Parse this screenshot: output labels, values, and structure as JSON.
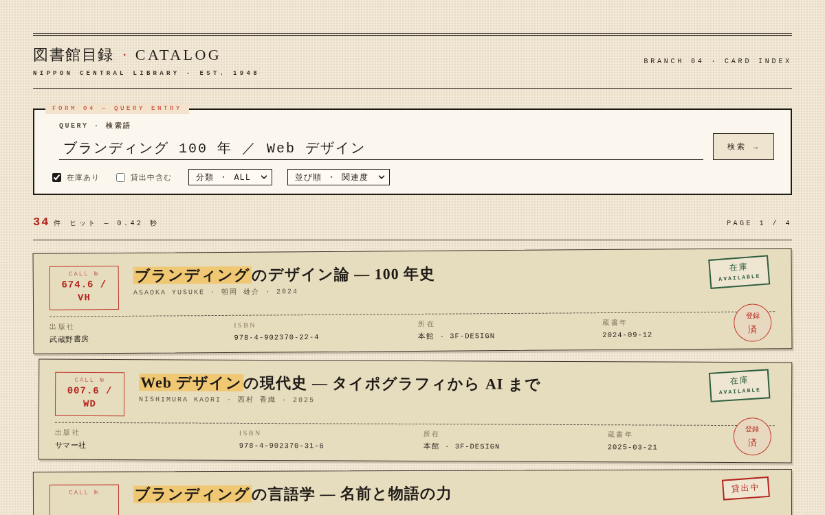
{
  "masthead": {
    "title": {
      "main": "図書館目録",
      "mark": "·",
      "sub": "CATALOG"
    },
    "subtitle": "NIPPON CENTRAL LIBRARY - EST. 1948",
    "branch": "BRANCH 04 · CARD INDEX"
  },
  "query_form": {
    "legend": "FORM 04 — QUERY ENTRY",
    "label": "QUERY · 検索語",
    "value": "ブランディング 100 年 ／ Web デザイン",
    "submit": "検索 →",
    "filters": [
      {
        "label": "在庫あり",
        "checked": true
      },
      {
        "label": "貸出中含む",
        "checked": false
      }
    ],
    "dropdowns": [
      {
        "value": "分類 ・ ALL"
      },
      {
        "value": "並び順 ・ 関連度"
      }
    ]
  },
  "results": {
    "count": "34",
    "summary": "件 ヒット — 0.42 秒",
    "page": "PAGE 1 / 4"
  },
  "cards": [
    {
      "call_label": "CALL №",
      "call_number": "674.6 / VH",
      "title": [
        {
          "text": "ブランディング",
          "highlighted": true
        },
        {
          "text": "のデザイン論 — 100 年史",
          "highlighted": false
        }
      ],
      "author": "ASAOKA YUSUKE · 朝岡 雄介 · 2024",
      "status": {
        "kind": "available",
        "lines": [
          "在庫",
          "AVAILABLE"
        ]
      },
      "fields": [
        {
          "label": "出版社",
          "value": "武蔵野書房",
          "kind": "text"
        },
        {
          "label": "ISBN",
          "value": "978-4-902370-22-4",
          "kind": "code"
        },
        {
          "label": "所在",
          "value": "本館 · 3F-DESIGN",
          "kind": "code"
        },
        {
          "label": "蔵書年",
          "value": "2024-09-12",
          "kind": "code"
        }
      ],
      "seal": [
        "登録",
        "済"
      ]
    },
    {
      "call_label": "CALL №",
      "call_number": "007.6 / WD",
      "title": [
        {
          "text": "Web デザイン",
          "highlighted": true
        },
        {
          "text": "の現代史 — タイポグラフィから AI まで",
          "highlighted": false
        }
      ],
      "author": "NISHIMURA KAORI · 西村 香織 · 2025",
      "status": {
        "kind": "available",
        "lines": [
          "在庫",
          "AVAILABLE"
        ]
      },
      "fields": [
        {
          "label": "出版社",
          "value": "サマー社",
          "kind": "text"
        },
        {
          "label": "ISBN",
          "value": "978-4-902370-31-6",
          "kind": "code"
        },
        {
          "label": "所在",
          "value": "本館 · 3F-DESIGN",
          "kind": "code"
        },
        {
          "label": "蔵書年",
          "value": "2025-03-21",
          "kind": "code"
        }
      ],
      "seal": [
        "登録",
        "済"
      ]
    },
    {
      "call_label": "CALL №",
      "title": [
        {
          "text": "ブランディング",
          "highlighted": true
        },
        {
          "text": "の言語学 — 名前と物語の力",
          "highlighted": false
        }
      ],
      "status": {
        "kind": "on_loan",
        "lines": [
          "貸出中"
        ]
      }
    }
  ]
}
